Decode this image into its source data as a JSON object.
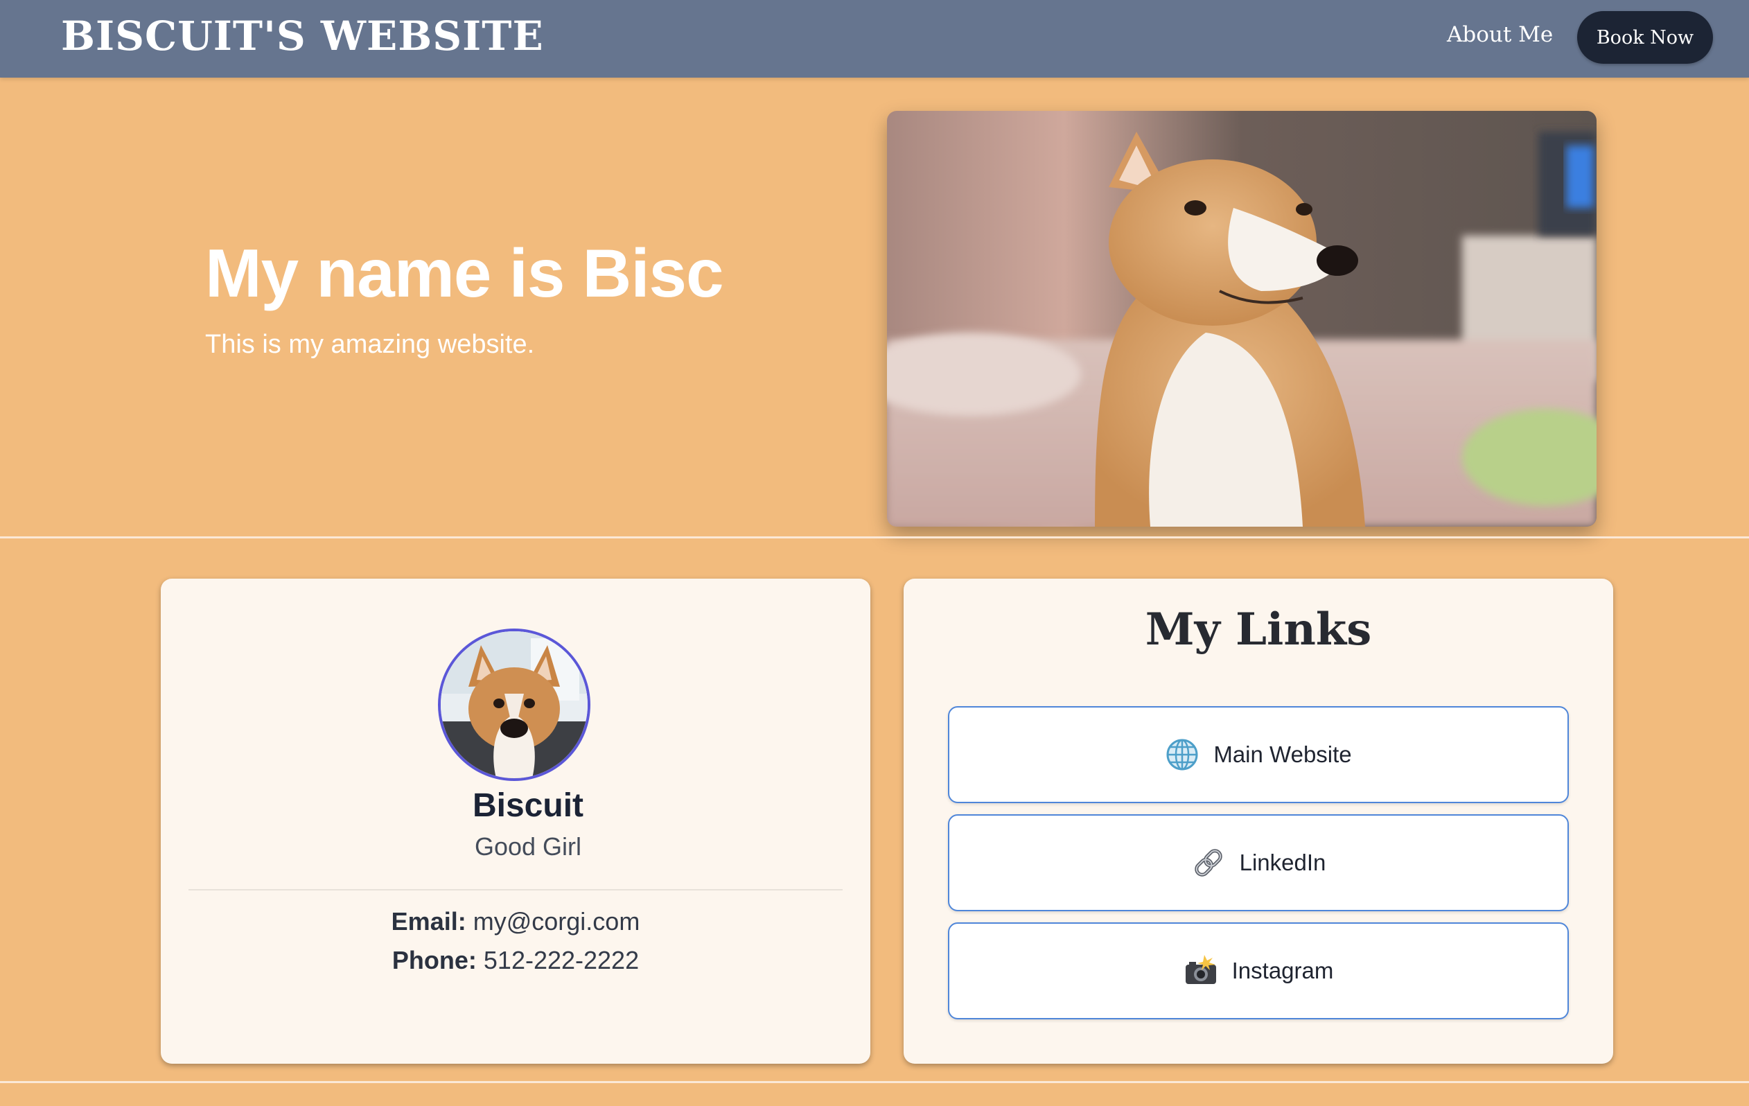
{
  "navbar": {
    "brand": "BISCUIT'S WEBSITE",
    "about_label": "About Me",
    "book_label": "Book Now"
  },
  "hero": {
    "title": "My name is Bisc",
    "subtitle": "This is my amazing website."
  },
  "profile": {
    "name": "Biscuit",
    "role": "Good Girl",
    "email_label": "Email:",
    "email": "my@corgi.com",
    "phone_label": "Phone:",
    "phone": "512-222-2222"
  },
  "links": {
    "title": "My Links",
    "items": [
      {
        "label": "Main Website",
        "icon": "globe-icon"
      },
      {
        "label": "LinkedIn",
        "icon": "link-icon"
      },
      {
        "label": "Instagram",
        "icon": "camera-flash-icon"
      }
    ]
  },
  "colors": {
    "page_bg": "#f2bb7d",
    "navbar_bg": "#66758f",
    "button_dark": "#1c2434",
    "card_bg": "#fdf6ee",
    "avatar_ring": "#5b57d8",
    "link_border": "#4f86d9"
  }
}
